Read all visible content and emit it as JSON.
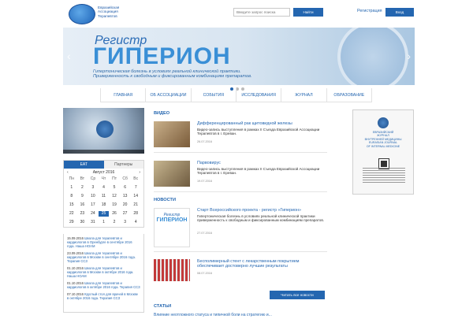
{
  "header": {
    "logo_text": [
      "Евразийская",
      "Ассоциация",
      "Терапевтов"
    ],
    "search_placeholder": "Введите запрос поиска",
    "search_button": "Найти",
    "register_link": "Регистрация",
    "login_button": "Вход"
  },
  "banner": {
    "registry_word": "Регистр",
    "title": "ГИПЕРИОН",
    "description_line1": "Гипертоническая болезнь в условиях реальной клинической практики.",
    "description_line2": "Приверженность к свободным и фиксированным комбинациям препаратов.",
    "slides_total": 3,
    "active_slide": 1
  },
  "nav": {
    "items": [
      "ГЛАВНАЯ",
      "ОБ АССОЦИАЦИИ",
      "СОБЫТИЯ",
      "ИССЛЕДОВАНИЯ",
      "ЖУРНАЛ",
      "ОБРАЗОВАНИЕ"
    ]
  },
  "calendar": {
    "tabs": [
      "ЕАТ",
      "Партнеры"
    ],
    "active_tab": 0,
    "prev": "‹",
    "next": "›",
    "month_label": "Август 2016",
    "weekdays": [
      "Пн",
      "Вт",
      "Ср",
      "Чт",
      "Пт",
      "Сб",
      "Вс"
    ],
    "rows": [
      [
        "1",
        "2",
        "3",
        "4",
        "5",
        "6",
        "7"
      ],
      [
        "8",
        "9",
        "10",
        "11",
        "12",
        "13",
        "14"
      ],
      [
        "15",
        "16",
        "17",
        "18",
        "19",
        "20",
        "21"
      ],
      [
        "22",
        "23",
        "24",
        "25",
        "26",
        "27",
        "28"
      ],
      [
        "29",
        "30",
        "31",
        "1",
        "2",
        "3",
        "4"
      ]
    ],
    "today": "25"
  },
  "events": [
    {
      "date": "15.09.2016",
      "text": "Школа для терапевтов и кардиологов в Оренбурге в сентябре 2016 года. Наша НОАМ"
    },
    {
      "date": "23.09.2016",
      "text": "Школа для терапевтов и кардиологов в Москве в сентябре 2016 года. Терапия ССЗ"
    },
    {
      "date": "01.10.2016",
      "text": "Школа для терапевтов и кардиологов в Москве в октябре 2016 года. Наша НОАМ"
    },
    {
      "date": "01.10.2016",
      "text": "Школа для терапевтов и кардиологов в октябре 2016 года. Терапия ССЗ"
    },
    {
      "date": "07.10.2016",
      "text": "Круглый стол для врачей в Москве в октябре 2016 года. Терапия ССЗ"
    }
  ],
  "video_section": {
    "title": "ВИДЕО",
    "items": [
      {
        "title": "Дифференцированный рак щитовидной железы",
        "desc": "Видео-запись выступления в рамках II Съезда Евразийской Ассоциации Терапевтов в г. Ереван.",
        "date": "26.07.2016"
      },
      {
        "title": "Парвовирус",
        "desc": "Видео-запись выступления в рамках II Съезда Евразийской Ассоциации Терапевтов в г. Ереван.",
        "date": "19.07.2016"
      }
    ]
  },
  "news_section": {
    "title": "НОВОСТИ",
    "items": [
      {
        "title": "Старт Всероссийского проекта - регистр «Гиперион»",
        "desc": "Гипертоническая болезнь в условиях реальной клинической практики приверженность к свободным и фиксированным комбинациям препаратов.",
        "date": "27.07.2016"
      },
      {
        "title": "Бесполимерный стент с лекарственным покрытием обеспечивает достоверно лучшие результаты",
        "desc": "",
        "date": "08.07.2016"
      }
    ],
    "all_news_button": "Читать все новости",
    "news_thumb_registry": "Регистр",
    "news_thumb_title": "ГИПЕРИОН"
  },
  "articles_section": {
    "title": "СТАТЬИ",
    "teaser": "Влияние неотложного статуса и типичной боли на стратегию и..."
  },
  "journal": {
    "lines": [
      "ЕВРАЗИЙСКИЙ",
      "ЖУРНАЛ",
      "ВНУТРЕННЕЙ МЕДИЦИНЫ",
      "EURASIAN JOURNAL",
      "OF INTERNAL MEDICINE"
    ]
  },
  "colors": {
    "brand_blue": "#2466b0",
    "banner_light": "#d8e5f1",
    "banner_title": "#3a8fd6"
  }
}
